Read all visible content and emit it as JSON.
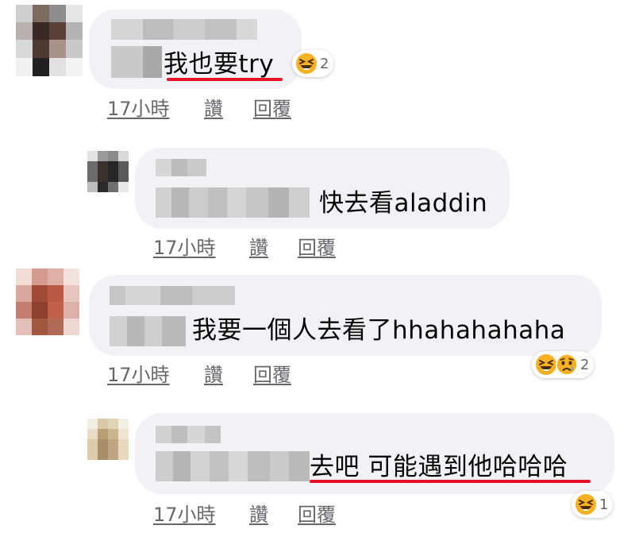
{
  "comments": [
    {
      "text": "我也要try",
      "actions": {
        "time": "17小時",
        "like": "讚",
        "reply": "回覆"
      },
      "reactions": {
        "icons": [
          "laughing-emoji"
        ],
        "count": "2"
      }
    },
    {
      "text": "快去看aladdin",
      "actions": {
        "time": "17小時",
        "like": "讚",
        "reply": "回覆"
      }
    },
    {
      "text": "我要一個人去看了hhahahahaha",
      "actions": {
        "time": "17小時",
        "like": "讚",
        "reply": "回覆"
      },
      "reactions": {
        "icons": [
          "laughing-emoji",
          "sad-emoji"
        ],
        "count": "2"
      }
    },
    {
      "text": "去吧 可能遇到他哈哈哈",
      "actions": {
        "time": "17小時",
        "like": "讚",
        "reply": "回覆"
      },
      "reactions": {
        "icons": [
          "laughing-emoji"
        ],
        "count": "1"
      }
    }
  ],
  "colors": {
    "bubble": "#f0f2f5",
    "meta_text": "#65676b",
    "underline_mark": "#e8102a"
  }
}
